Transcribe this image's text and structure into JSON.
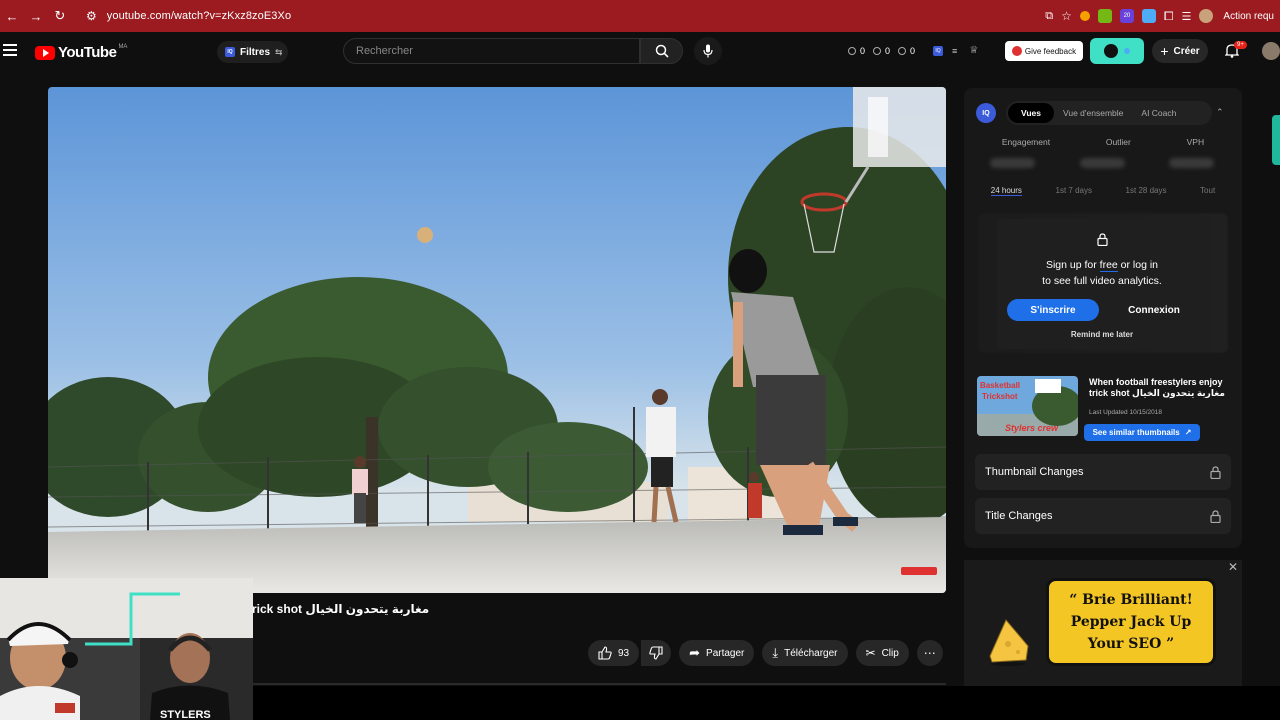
{
  "browser": {
    "url": "youtube.com/watch?v=zKxz8zoE3Xo",
    "action_text": "Action requ",
    "ext_badge": "20"
  },
  "header": {
    "logo_text": "YouTube",
    "logo_region": "MA",
    "filter_label": "Filtres",
    "search_placeholder": "Rechercher",
    "stats": [
      "0",
      "0",
      "0"
    ],
    "feedback_label": "Give feedback",
    "create_label": "Créer",
    "notif_count": "9+"
  },
  "video": {
    "title_fragment": "rick shot مغاربة يتحدون الخيال"
  },
  "actions": {
    "like_count": "93",
    "share_label": "Partager",
    "download_label": "Télécharger",
    "clip_label": "Clip"
  },
  "panel": {
    "iq_label": "IQ",
    "tabs": [
      "Vues",
      "Vue d'ensemble",
      "AI Coach"
    ],
    "metrics": [
      "Engagement",
      "Outlier",
      "VPH"
    ],
    "ranges": [
      "24 hours",
      "1st 7 days",
      "1st 28 days",
      "Tout"
    ],
    "lock_msg_pre": "Sign up for ",
    "lock_msg_free": "free",
    "lock_msg_post": " or log in",
    "lock_msg_line2": "to see full video analytics.",
    "signup_label": "S'inscrire",
    "login_label": "Connexion",
    "remind_label": "Remind me later",
    "rec_title": "When football freestylers enjoy trick shot مغاربة يتحدون الخيال",
    "rec_date": "Last Updated 10/15/2018",
    "similar_label": "See similar thumbnails",
    "thumb_text_1": "Basketball",
    "thumb_text_2": "Trickshot",
    "thumb_text_3": "Stylers crew",
    "thumbnail_changes_label": "Thumbnail Changes",
    "title_changes_label": "Title Changes"
  },
  "ad": {
    "text": "“ Brie Brilliant! Pepper Jack Up Your SEO ”"
  },
  "colors": {
    "browser_red": "#9b1b20",
    "accent_blue": "#1e6fe8",
    "teal": "#3fe0c5",
    "ad_yellow": "#f3c623"
  }
}
